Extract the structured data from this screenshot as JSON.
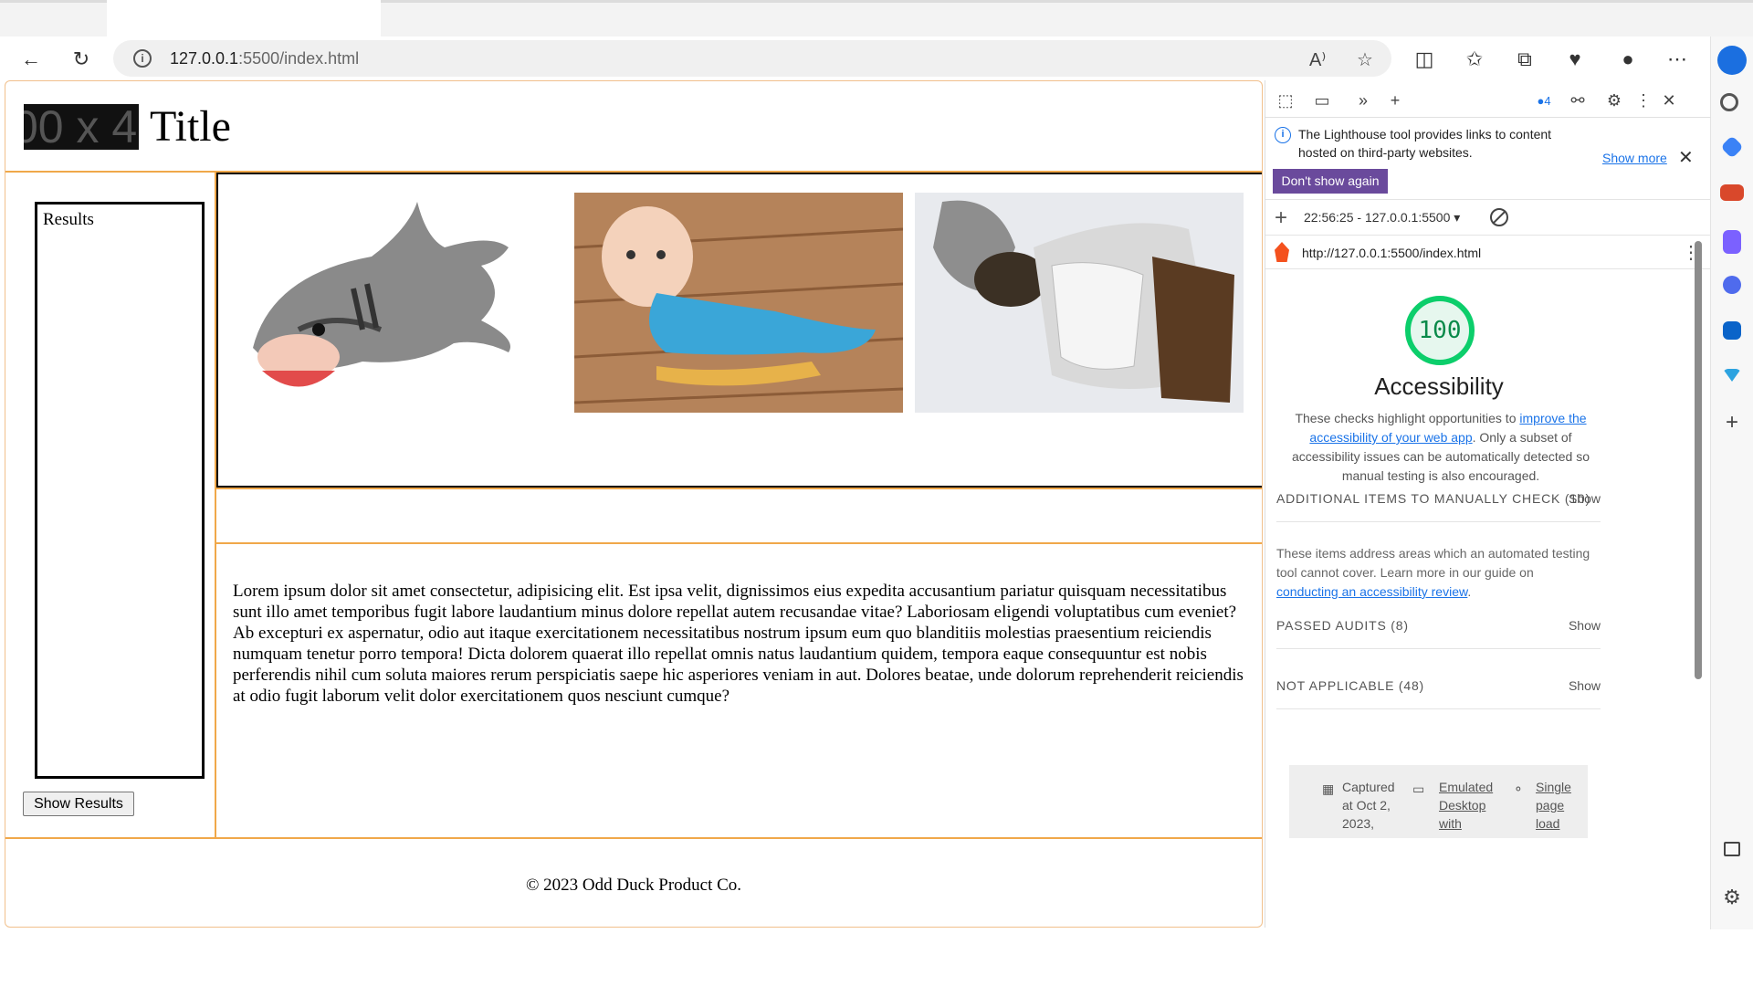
{
  "browser": {
    "url_host": "127.0.0.1",
    "url_path": ":5500/index.html"
  },
  "page": {
    "logo_text": "00 x 4",
    "title": "Title",
    "results_label": "Results",
    "show_results_button": "Show Results",
    "content": "Lorem ipsum dolor sit amet consectetur, adipisicing elit. Est ipsa velit, dignissimos eius expedita accusantium pariatur quisquam necessitatibus sunt illo amet temporibus fugit labore laudantium minus dolore repellat autem recusandae vitae? Laboriosam eligendi voluptatibus cum eveniet? Ab excepturi ex aspernatur, odio aut itaque exercitationem necessitatibus nostrum ipsum eum quo blanditiis molestias praesentium reiciendis numquam tenetur porro tempora! Dicta dolorem quaerat illo repellat omnis natus laudantium quidem, tempora eaque consequuntur est nobis perferendis nihil cum soluta maiores rerum perspiciatis saepe hic asperiores veniam in aut. Dolores beatae, unde dolorum reprehenderit reiciendis at odio fugit laborum velit dolor exercitationem quos nesciunt cumque?",
    "footer": "© 2023 Odd Duck Product Co."
  },
  "devtools": {
    "issues_count": "4",
    "banner_text": "The Lighthouse tool provides links to content hosted on third-party websites.",
    "show_more": "Show more",
    "dont_show_again": "Don't show again",
    "run_label": "22:56:25 - 127.0.0.1:5500",
    "report_url": "http://127.0.0.1:5500/index.html",
    "score": "100",
    "category_title": "Accessibility",
    "desc_before": "These checks highlight opportunities to ",
    "desc_link": "improve the accessibility of your web app",
    "desc_after": ". Only a subset of accessibility issues can be automatically detected so manual testing is also encouraged.",
    "sections": [
      {
        "label": "ADDITIONAL ITEMS TO MANUALLY CHECK (10)",
        "action": "Show"
      },
      {
        "label": "PASSED AUDITS (8)",
        "action": "Show"
      },
      {
        "label": "NOT APPLICABLE (48)",
        "action": "Show"
      }
    ],
    "manual_before": "These items address areas which an automated testing tool cannot cover. Learn more in our guide on ",
    "manual_link": "conducting an accessibility review",
    "manual_after": ".",
    "captured": "Captured at Oct 2, 2023,",
    "emulated": "Emulated Desktop with",
    "single": "Single page load"
  },
  "colors": {
    "accent_border": "#f0a84a",
    "score_green": "#0cce6b",
    "link_blue": "#1a73e8",
    "button_purple": "#6a4a9c"
  }
}
